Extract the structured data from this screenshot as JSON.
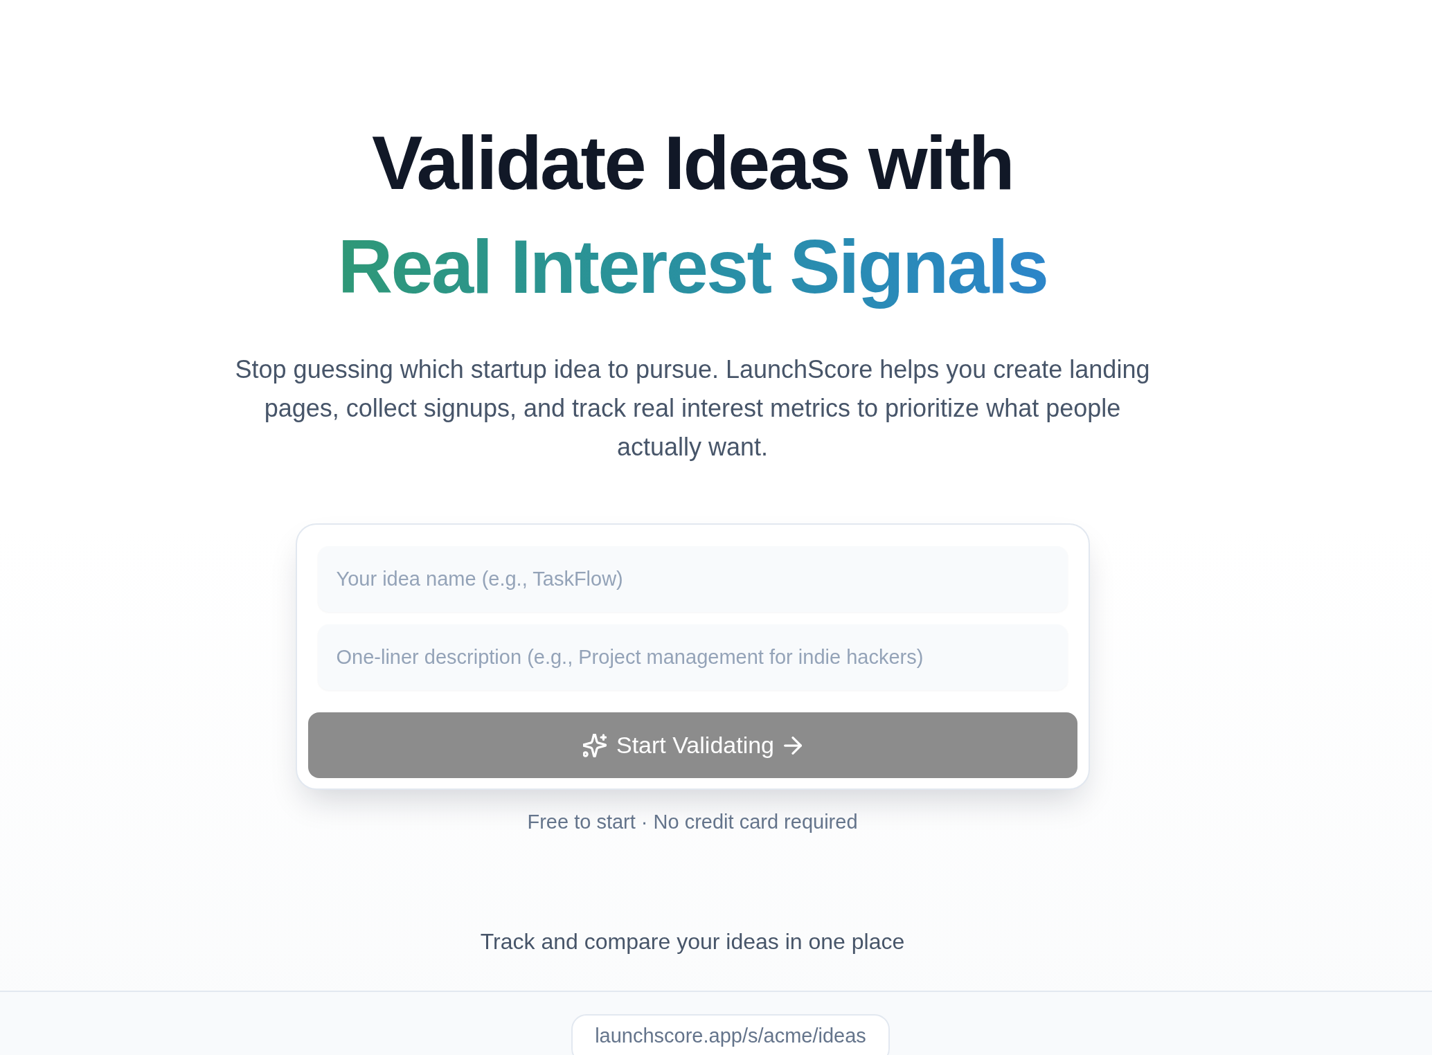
{
  "hero": {
    "title": "Validate Ideas with",
    "title_highlight": "Real Interest Signals",
    "subtitle": "Stop guessing which startup idea to pursue. LaunchScore helps you create landing pages, collect signups, and track real interest metrics to prioritize what people actually want."
  },
  "form": {
    "fields": [
      {
        "placeholder": "Your idea name (e.g., TaskFlow)"
      },
      {
        "placeholder": "One-liner description (e.g., Project management for indie hackers)"
      }
    ],
    "submit": {
      "label": "Start Validating",
      "disabled": true
    }
  },
  "note": "Free to start · No credit card required",
  "preview": {
    "caption": "Track and compare your ideas in one place",
    "url": "launchscore.app/s/acme/ideas"
  }
}
